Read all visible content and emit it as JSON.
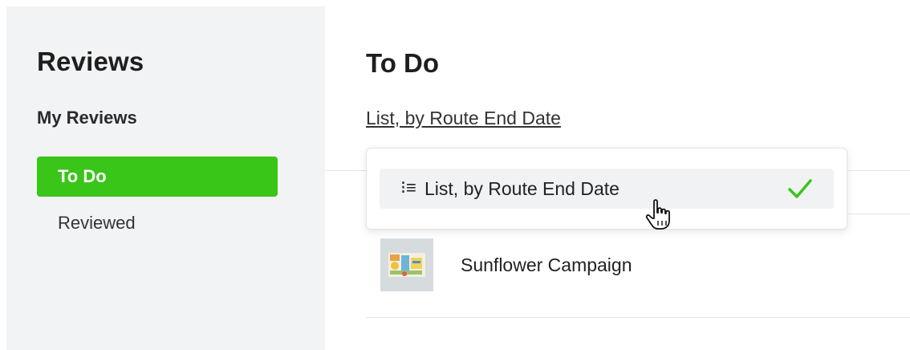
{
  "sidebar": {
    "title": "Reviews",
    "section_label": "My Reviews",
    "items": [
      {
        "label": "To Do",
        "active": true
      },
      {
        "label": "Reviewed",
        "active": false
      }
    ]
  },
  "main": {
    "title": "To Do",
    "view_selector_label": "List, by Route End Date",
    "dropdown": {
      "options": [
        {
          "label": "List, by Route End Date",
          "icon": "list-icon",
          "selected": true
        }
      ]
    },
    "reviews": [
      {
        "title": "Sunflower Campaign",
        "thumbnail": "campaign-thumbnail"
      }
    ]
  },
  "colors": {
    "accent": "#3ac519",
    "sidebar_bg": "#f2f3f5"
  }
}
